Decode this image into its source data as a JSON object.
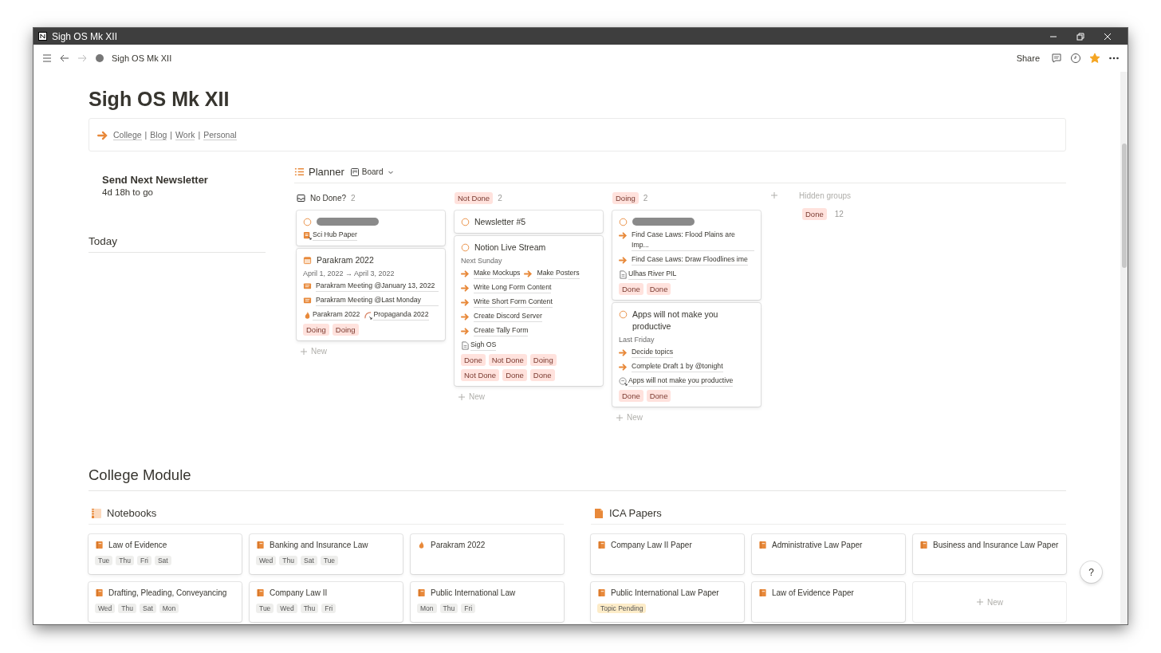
{
  "window": {
    "title": "Sigh OS Mk XII"
  },
  "topbar": {
    "breadcrumb": "Sigh OS Mk XII",
    "share": "Share",
    "favorite": true
  },
  "page": {
    "title": "Sigh OS Mk XII",
    "nav_links": [
      "College",
      "Blog",
      "Work",
      "Personal"
    ],
    "separator": "|"
  },
  "countdown": {
    "title": "Send Next Newsletter",
    "remaining": "4d 18h to go"
  },
  "today": {
    "heading": "Today"
  },
  "planner": {
    "title": "Planner",
    "view": "Board",
    "hidden_title": "Hidden groups",
    "hidden_groups": [
      {
        "label": "Done",
        "count": "12"
      }
    ],
    "columns": [
      {
        "label": "No Done?",
        "kind": "plain",
        "count": "2",
        "new_label": "New",
        "cards": [
          {
            "kind": "task",
            "redacted": true,
            "lines": [
              {
                "kind": "pages",
                "items": [
                  {
                    "kind": "note",
                    "text": "Sci Hub Paper"
                  }
                ]
              }
            ]
          },
          {
            "kind": "event",
            "redacted": false,
            "title": "Parakram 2022",
            "lines": [
              {
                "kind": "date",
                "text": "April 1, 2022 → April 3, 2022"
              },
              {
                "kind": "mention",
                "text": "Parakram Meeting @January 13, 2022"
              },
              {
                "kind": "mention",
                "text": "Parakram Meeting @Last Monday"
              },
              {
                "kind": "pages",
                "items": [
                  {
                    "kind": "flame",
                    "text": "Parakram 2022"
                  },
                  {
                    "kind": "curve",
                    "text": "Propaganda 2022"
                  }
                ]
              },
              {
                "kind": "tags",
                "items": [
                  "Doing",
                  "Doing"
                ]
              }
            ]
          }
        ]
      },
      {
        "label": "Not Done",
        "kind": "tag",
        "count": "2",
        "new_label": "New",
        "cards": [
          {
            "kind": "task",
            "redacted": false,
            "title": "Newsletter #5"
          },
          {
            "kind": "task",
            "redacted": false,
            "title": "Notion Live Stream",
            "lines": [
              {
                "kind": "date",
                "text": "Next Sunday"
              },
              {
                "kind": "tasks",
                "items": [
                  "Make Mockups",
                  "Make Posters"
                ]
              },
              {
                "kind": "tasks",
                "items": [
                  "Write Long Form Content"
                ]
              },
              {
                "kind": "tasks",
                "items": [
                  "Write Short Form Content"
                ]
              },
              {
                "kind": "tasks",
                "items": [
                  "Create Discord Server"
                ]
              },
              {
                "kind": "tasks",
                "items": [
                  "Create Tally Form"
                ]
              },
              {
                "kind": "pages",
                "items": [
                  {
                    "kind": "doc",
                    "text": "Sigh OS"
                  }
                ]
              },
              {
                "kind": "tags",
                "items": [
                  "Done",
                  "Not Done",
                  "Doing",
                  "Not Done",
                  "Done",
                  "Done"
                ]
              }
            ]
          }
        ]
      },
      {
        "label": "Doing",
        "kind": "tag",
        "count": "2",
        "new_label": "New",
        "cards": [
          {
            "kind": "task",
            "redacted": true,
            "lines": [
              {
                "kind": "tasks",
                "items": [
                  "Find Case Laws: Flood Plains are Imp..."
                ]
              },
              {
                "kind": "tasks",
                "items": [
                  "Find Case Laws: Draw Floodlines ime"
                ]
              },
              {
                "kind": "pages",
                "items": [
                  {
                    "kind": "doc",
                    "text": "Ulhas River PIL"
                  }
                ]
              },
              {
                "kind": "tags",
                "items": [
                  "Done",
                  "Done"
                ]
              }
            ]
          },
          {
            "kind": "task",
            "redacted": false,
            "title": "Apps will not make you productive",
            "lines": [
              {
                "kind": "date",
                "text": "Last Friday"
              },
              {
                "kind": "tasks",
                "items": [
                  "Decide topics"
                ]
              },
              {
                "kind": "tasks",
                "items": [
                  "Complete Draft 1 by @tonight"
                ]
              },
              {
                "kind": "pages",
                "items": [
                  {
                    "kind": "badge",
                    "text": "Apps will not make you productive"
                  }
                ]
              },
              {
                "kind": "tags",
                "items": [
                  "Done",
                  "Done"
                ]
              }
            ]
          }
        ]
      }
    ]
  },
  "college": {
    "heading": "College Module",
    "galleries": [
      {
        "title": "Notebooks",
        "kind": "notebook",
        "cards": [
          {
            "kind": "book",
            "title": "Law of Evidence",
            "tags": [
              {
                "label": "Tue",
                "color": "#eeeeec"
              },
              {
                "label": "Thu",
                "color": "#eeeeec"
              },
              {
                "label": "Fri",
                "color": "#eeeeec"
              },
              {
                "label": "Sat",
                "color": "#eeeeec"
              }
            ]
          },
          {
            "kind": "book",
            "title": "Banking and Insurance Law",
            "tags": [
              {
                "label": "Wed",
                "color": "#eeeeec"
              },
              {
                "label": "Thu",
                "color": "#eeeeec"
              },
              {
                "label": "Sat",
                "color": "#eeeeec"
              },
              {
                "label": "Tue",
                "color": "#eeeeec"
              }
            ]
          },
          {
            "kind": "flame",
            "title": "Parakram 2022"
          },
          {
            "kind": "book",
            "title": "Drafting, Pleading, Conveyancing",
            "tags": [
              {
                "label": "Wed",
                "color": "#eeeeec"
              },
              {
                "label": "Thu",
                "color": "#eeeeec"
              },
              {
                "label": "Sat",
                "color": "#eeeeec"
              },
              {
                "label": "Mon",
                "color": "#eeeeec"
              }
            ]
          },
          {
            "kind": "book",
            "title": "Company Law II",
            "tags": [
              {
                "label": "Tue",
                "color": "#eeeeec"
              },
              {
                "label": "Wed",
                "color": "#eeeeec"
              },
              {
                "label": "Thu",
                "color": "#eeeeec"
              },
              {
                "label": "Fri",
                "color": "#eeeeec"
              }
            ]
          },
          {
            "kind": "book",
            "title": "Public International Law",
            "tags": [
              {
                "label": "Mon",
                "color": "#eeeeec"
              },
              {
                "label": "Thu",
                "color": "#eeeeec"
              },
              {
                "label": "Fri",
                "color": "#eeeeec"
              }
            ]
          }
        ]
      },
      {
        "title": "ICA Papers",
        "kind": "paper",
        "new_label": "New",
        "cards": [
          {
            "kind": "book",
            "title": "Company Law II Paper"
          },
          {
            "kind": "book",
            "title": "Administrative Law Paper"
          },
          {
            "kind": "book",
            "title": "Business and Insurance Law Paper"
          },
          {
            "kind": "book",
            "title": "Public International Law Paper",
            "tags": [
              {
                "label": "Topic Pending",
                "color": "#fdecc8"
              }
            ]
          },
          {
            "kind": "book",
            "title": "Law of Evidence Paper"
          }
        ]
      }
    ]
  },
  "help": "?"
}
